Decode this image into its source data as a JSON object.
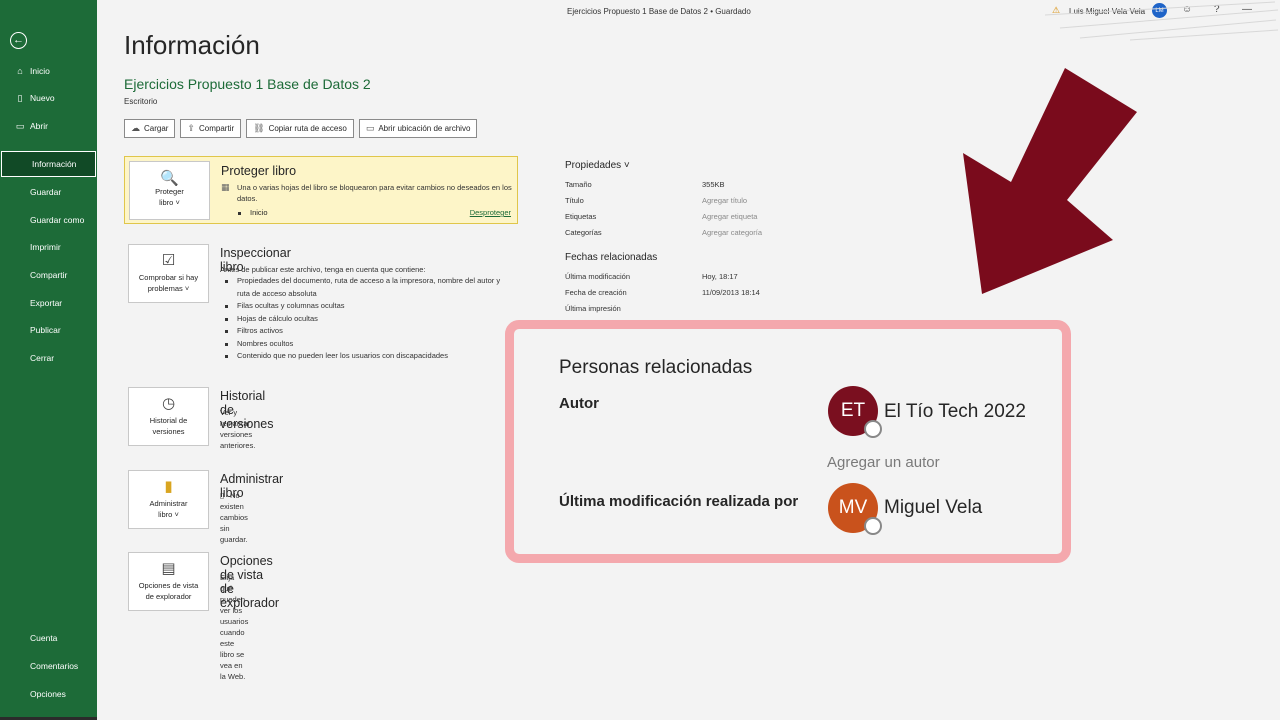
{
  "titlebar": {
    "doc_title": "Ejercicios Propuesto 1 Base de Datos 2 • Guardado",
    "user_name": "Luis Miguel Vela Vela",
    "user_initials": "LM",
    "warning_icon": "warning-icon",
    "feedback_icon": "feedback-icon",
    "help_icon": "help-icon"
  },
  "sidebar": {
    "back_icon": "back-arrow-icon",
    "items": [
      {
        "label": "Inicio",
        "icon": "home-icon"
      },
      {
        "label": "Nuevo",
        "icon": "new-file-icon"
      },
      {
        "label": "Abrir",
        "icon": "open-folder-icon"
      },
      {
        "label": "Información"
      },
      {
        "label": "Guardar"
      },
      {
        "label": "Guardar como"
      },
      {
        "label": "Imprimir"
      },
      {
        "label": "Compartir"
      },
      {
        "label": "Exportar"
      },
      {
        "label": "Publicar"
      },
      {
        "label": "Cerrar"
      }
    ],
    "bottom_items": [
      {
        "label": "Cuenta"
      },
      {
        "label": "Comentarios"
      },
      {
        "label": "Opciones"
      }
    ],
    "accent": "#1d6b38"
  },
  "main": {
    "title": "Información",
    "file_name": "Ejercicios Propuesto 1 Base de Datos 2",
    "file_location": "Escritorio",
    "actions": [
      {
        "label": "Cargar",
        "icon": "upload-icon"
      },
      {
        "label": "Compartir",
        "icon": "share-icon"
      },
      {
        "label": "Copiar ruta de acceso",
        "icon": "copy-link-icon"
      },
      {
        "label": "Abrir ubicación de archivo",
        "icon": "folder-icon"
      }
    ],
    "protect": {
      "tile_line1": "Proteger",
      "tile_line2": "libro",
      "title": "Proteger libro",
      "desc": "Una o varias hojas del libro se bloquearon para evitar cambios no deseados en los datos.",
      "bullet": "Inicio",
      "unprotect": "Desproteger"
    },
    "inspect": {
      "tile_line1": "Comprobar si hay",
      "tile_line2": "problemas",
      "title": "Inspeccionar libro",
      "desc": "Antes de publicar este archivo, tenga en cuenta que contiene:",
      "bullets": [
        "Propiedades del documento, ruta de acceso a la impresora, nombre del autor y ruta de acceso absoluta",
        "Filas ocultas y columnas ocultas",
        "Hojas de cálculo ocultas",
        "Filtros activos",
        "Nombres ocultos",
        "Contenido que no pueden leer los usuarios con discapacidades"
      ]
    },
    "history": {
      "tile_line1": "Historial de",
      "tile_line2": "versiones",
      "title": "Historial de versiones",
      "desc": "Ver y restaurar versiones anteriores."
    },
    "manage": {
      "tile_line1": "Administrar",
      "tile_line2": "libro",
      "title": "Administrar libro",
      "desc": "No existen cambios sin guardar."
    },
    "browser": {
      "tile_line1": "Opciones de vista",
      "tile_line2": "de explorador",
      "title": "Opciones de vista de explorador",
      "desc": "Elija qué pueden ver los usuarios cuando este libro se vea en la Web."
    }
  },
  "properties": {
    "header": "Propiedades",
    "rows": [
      {
        "key": "Tamaño",
        "value": "355KB"
      },
      {
        "key": "Título",
        "value": "Agregar título"
      },
      {
        "key": "Etiquetas",
        "value": "Agregar etiqueta"
      },
      {
        "key": "Categorías",
        "value": "Agregar categoría"
      }
    ],
    "dates_header": "Fechas relacionadas",
    "dates": [
      {
        "key": "Última modificación",
        "value": "Hoy, 18:17"
      },
      {
        "key": "Fecha de creación",
        "value": "11/09/2013 18:14"
      },
      {
        "key": "Última impresión",
        "value": ""
      }
    ]
  },
  "related_people": {
    "title": "Personas relacionadas",
    "author_label": "Autor",
    "author_initials": "ET",
    "author_name": "El Tío Tech 2022",
    "author_color": "#7a0f1f",
    "add_author": "Agregar un autor",
    "lastmod_label": "Última modificación realizada por",
    "lastmod_initials": "MV",
    "lastmod_name": "Miguel Vela",
    "lastmod_color": "#c9521c",
    "frame_color": "#f4a8ad"
  },
  "annotation": {
    "arrow_color": "#7a0b1c"
  }
}
